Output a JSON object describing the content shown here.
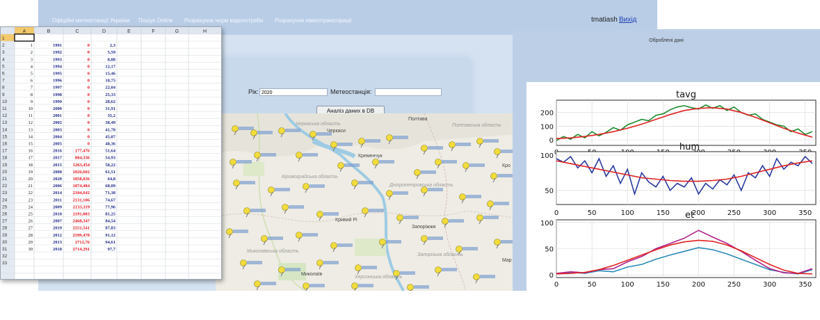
{
  "webapp": {
    "nav": [
      "Офіційні метеостанції України",
      "Пошук Online",
      "Розрахунок норм водопотреби",
      "Розрахунок евапотранспірації"
    ],
    "user": "tmatiash",
    "logout": "Вихід",
    "form": {
      "year_label": "Рік:",
      "year_value": "2020",
      "station_label": "Метеостанція:",
      "station_value": "",
      "analyze_button": "Аналіз даних в DB"
    },
    "map": {
      "places": [
        "Полтава",
        "Черкаси",
        "Кременчук",
        "Кривий Рі",
        "Запоріжжя",
        "Миколаїв",
        "Мар"
      ],
      "regions": [
        "Черкаська область",
        "Полтавська область",
        "Кіровоградська область",
        "Дніпропетровська область",
        "Запорізька область",
        "Миколаївська область",
        "Херсонська область",
        "Кро"
      ],
      "marker_color": "#f1dc3c"
    }
  },
  "spreadsheet": {
    "columns": [
      "A",
      "B",
      "C",
      "D",
      "E",
      "F",
      "G",
      "H"
    ],
    "row_numbers": [
      "1",
      "2",
      "3",
      "4",
      "5",
      "6",
      "7",
      "8",
      "9",
      "10",
      "11",
      "12",
      "13",
      "14",
      "15",
      "16",
      "17",
      "18",
      "19",
      "20",
      "21",
      "22",
      "23",
      "24",
      "25",
      "26",
      "27",
      "28",
      "29",
      "30",
      "31",
      "32",
      "33"
    ],
    "data": [
      [
        "1",
        "1991",
        "0",
        "2,3"
      ],
      [
        "2",
        "1992",
        "0",
        "5,59"
      ],
      [
        "3",
        "1993",
        "0",
        "8,88"
      ],
      [
        "4",
        "1994",
        "0",
        "12,17"
      ],
      [
        "5",
        "1995",
        "0",
        "15,46"
      ],
      [
        "6",
        "1996",
        "0",
        "18,75"
      ],
      [
        "7",
        "1997",
        "0",
        "22,04"
      ],
      [
        "8",
        "1998",
        "0",
        "25,33"
      ],
      [
        "9",
        "1999",
        "0",
        "28,62"
      ],
      [
        "10",
        "2000",
        "0",
        "31,91"
      ],
      [
        "11",
        "2001",
        "0",
        "35,2"
      ],
      [
        "12",
        "2002",
        "0",
        "38,49"
      ],
      [
        "13",
        "2003",
        "0",
        "41,78"
      ],
      [
        "14",
        "2004",
        "0",
        "45,07"
      ],
      [
        "15",
        "2005",
        "0",
        "48,36"
      ],
      [
        "16",
        "2016",
        "177,476",
        "51,64"
      ],
      [
        "17",
        "2017",
        "884,336",
        "54,93"
      ],
      [
        "18",
        "2015",
        "1263,454",
        "58,22"
      ],
      [
        "19",
        "2008",
        "1826,602",
        "61,51"
      ],
      [
        "20",
        "2020",
        "1858,836",
        "64,8"
      ],
      [
        "21",
        "2006",
        "1874,484",
        "68,09"
      ],
      [
        "22",
        "2014",
        "2104,642",
        "71,38"
      ],
      [
        "23",
        "2011",
        "2131,106",
        "74,67"
      ],
      [
        "24",
        "2009",
        "2133,319",
        "77,96"
      ],
      [
        "25",
        "2010",
        "2191,003",
        "81,25"
      ],
      [
        "26",
        "2007",
        "2468,347",
        "84,54"
      ],
      [
        "27",
        "2019",
        "2551,541",
        "87,83"
      ],
      [
        "28",
        "2012",
        "2599,478",
        "91,12"
      ],
      [
        "29",
        "2013",
        "2712,76",
        "94,61"
      ],
      [
        "30",
        "2018",
        "2714,291",
        "97,7"
      ]
    ],
    "colors": {
      "col_b": "#1f2a8a",
      "col_c": "#e3121b",
      "col_d": "#1f2a8a"
    }
  },
  "plot_window": {
    "title": "Оброблені дані"
  },
  "chart_data": [
    {
      "type": "line",
      "title": "tavg",
      "xlim": [
        0,
        365
      ],
      "ylim": [
        -40,
        290
      ],
      "x_ticks": [
        0,
        50,
        100,
        150,
        200,
        250,
        300,
        350
      ],
      "y_ticks": [
        0,
        100,
        200
      ],
      "grid": true,
      "series": [
        {
          "color": "#1a8a2a",
          "x": [
            0,
            10,
            20,
            30,
            40,
            50,
            60,
            70,
            80,
            90,
            100,
            110,
            120,
            130,
            140,
            150,
            160,
            170,
            180,
            190,
            200,
            210,
            220,
            230,
            240,
            250,
            260,
            270,
            280,
            290,
            300,
            310,
            320,
            330,
            340,
            350,
            360
          ],
          "y": [
            -5,
            25,
            5,
            40,
            15,
            60,
            30,
            55,
            90,
            70,
            110,
            130,
            150,
            140,
            180,
            190,
            220,
            240,
            250,
            235,
            225,
            255,
            230,
            250,
            215,
            240,
            200,
            180,
            190,
            150,
            130,
            110,
            100,
            60,
            80,
            40,
            60
          ]
        },
        {
          "color": "#e02020",
          "x": [
            0,
            20,
            40,
            60,
            80,
            100,
            120,
            140,
            160,
            180,
            200,
            220,
            240,
            260,
            280,
            300,
            320,
            340,
            360
          ],
          "y": [
            10,
            15,
            25,
            40,
            60,
            85,
            115,
            150,
            185,
            215,
            230,
            235,
            225,
            200,
            165,
            125,
            85,
            50,
            20
          ]
        }
      ]
    },
    {
      "type": "line",
      "title": "hum",
      "xlim": [
        0,
        365
      ],
      "ylim": [
        30,
        105
      ],
      "x_ticks": [
        0,
        50,
        100,
        150,
        200,
        250,
        300,
        350
      ],
      "y_ticks": [
        50,
        100
      ],
      "grid": true,
      "series": [
        {
          "color": "#2a3aa0",
          "x": [
            0,
            10,
            20,
            30,
            40,
            50,
            60,
            70,
            80,
            90,
            100,
            110,
            120,
            130,
            140,
            150,
            160,
            170,
            180,
            190,
            200,
            210,
            220,
            230,
            240,
            250,
            260,
            270,
            280,
            290,
            300,
            310,
            320,
            330,
            340,
            350,
            360
          ],
          "y": [
            95,
            90,
            98,
            82,
            92,
            75,
            95,
            70,
            85,
            60,
            80,
            45,
            75,
            62,
            55,
            70,
            50,
            60,
            55,
            68,
            45,
            60,
            52,
            65,
            58,
            72,
            50,
            75,
            68,
            85,
            70,
            95,
            80,
            90,
            85,
            98,
            88
          ]
        },
        {
          "color": "#e02020",
          "x": [
            0,
            20,
            40,
            60,
            80,
            100,
            120,
            140,
            160,
            180,
            200,
            220,
            240,
            260,
            280,
            300,
            320,
            340,
            360
          ],
          "y": [
            92,
            88,
            84,
            80,
            76,
            72,
            68,
            66,
            64,
            63,
            63,
            64,
            66,
            70,
            75,
            80,
            85,
            89,
            92
          ]
        }
      ]
    },
    {
      "type": "line",
      "title": "et",
      "xlim": [
        0,
        365
      ],
      "ylim": [
        -5,
        105
      ],
      "x_ticks": [
        0,
        50,
        100,
        150,
        200,
        250,
        300,
        350
      ],
      "y_ticks": [
        0,
        50,
        100
      ],
      "grid": true,
      "series": [
        {
          "color": "#2a8ab8",
          "x": [
            0,
            20,
            40,
            60,
            80,
            100,
            120,
            140,
            160,
            180,
            200,
            220,
            240,
            260,
            280,
            300,
            320,
            340,
            360
          ],
          "y": [
            2,
            5,
            3,
            8,
            6,
            15,
            20,
            30,
            38,
            45,
            52,
            48,
            40,
            30,
            20,
            10,
            5,
            2,
            10
          ]
        },
        {
          "color": "#b0208a",
          "x": [
            0,
            20,
            40,
            60,
            80,
            100,
            120,
            140,
            160,
            180,
            200,
            220,
            240,
            260,
            280,
            300,
            320,
            340,
            360
          ],
          "y": [
            3,
            6,
            4,
            10,
            12,
            25,
            35,
            50,
            60,
            70,
            85,
            72,
            60,
            45,
            28,
            12,
            4,
            3,
            12
          ]
        },
        {
          "color": "#e02020",
          "x": [
            0,
            20,
            40,
            60,
            80,
            100,
            120,
            140,
            160,
            180,
            200,
            220,
            240,
            260,
            280,
            300,
            320,
            340,
            360
          ],
          "y": [
            2,
            3,
            5,
            10,
            18,
            28,
            38,
            48,
            57,
            63,
            66,
            64,
            57,
            46,
            33,
            20,
            9,
            3,
            2
          ]
        }
      ]
    }
  ]
}
